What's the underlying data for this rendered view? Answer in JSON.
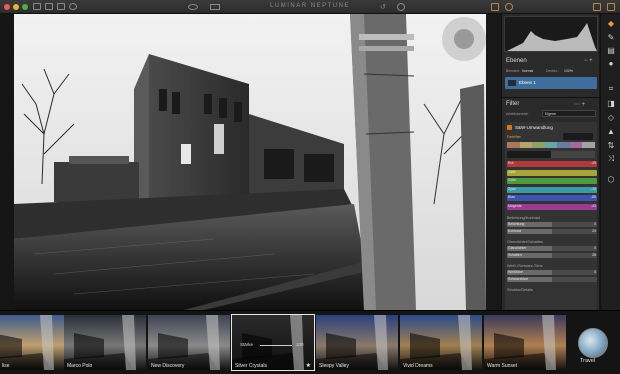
{
  "window": {
    "title": "LUMINAR NEPTUNE"
  },
  "layers": {
    "header": "Ebenen",
    "blend_label": "Blenden:",
    "blend_value": "Normal",
    "opacity_label": "Deckkr.:",
    "opacity_value": "100%",
    "layer_name": "Ebene 1"
  },
  "filter": {
    "header": "Filter",
    "workspace_label": "Arbeitsbereich",
    "workspace_value": "Eigene",
    "name": "S&W-Umwandlung",
    "farbfilter_label": "Farbfilter",
    "farbfilter_button": "Erweitert",
    "tab_luminanz": "Luminanz",
    "tab_saettigung": "Sättigung",
    "channels": [
      {
        "label": "Rot",
        "value": "-45",
        "color": "#b03a3a"
      },
      {
        "label": "Gelb",
        "value": "",
        "color": "#a8a53a"
      },
      {
        "label": "Grün",
        "value": "",
        "color": "#4f9a3c"
      },
      {
        "label": "Zyan",
        "value": "-14",
        "color": "#3b9aa3"
      },
      {
        "label": "Blau",
        "value": "-88",
        "color": "#3b54b0"
      },
      {
        "label": "Magenta",
        "value": "-43",
        "color": "#9a3b92"
      }
    ],
    "section_brightness": "Belichtung/Kontrast",
    "brightness_rows": [
      {
        "label": "Belichtung",
        "value": "0"
      },
      {
        "label": "Kontrast",
        "value": "24"
      }
    ],
    "section_glow": "Glanzlichter/Schatten",
    "glow_rows": [
      {
        "label": "Glanzlichter",
        "value": "0"
      },
      {
        "label": "Schatten",
        "value": "28"
      }
    ],
    "section_whites": "Weiß-/Schwarz-Töne",
    "white_rows": [
      {
        "label": "Weißtöne",
        "value": "0"
      },
      {
        "label": "Schwarztöne",
        "value": ""
      }
    ],
    "section_more": "Struktur/Details"
  },
  "presets": [
    {
      "name": "lise"
    },
    {
      "name": "Marco Polo"
    },
    {
      "name": "New Discovery"
    },
    {
      "name": "Silver Crystals",
      "selected": true,
      "slider_label": "Stärke",
      "slider_value": "100",
      "starred": true
    },
    {
      "name": "Sleepy Valley"
    },
    {
      "name": "Vivid Dreams"
    },
    {
      "name": "Warm Sunset"
    }
  ],
  "category": {
    "name": "Travel"
  },
  "icons": {
    "toolbar": [
      "layers-icon",
      "brush-icon",
      "palette-icon",
      "circle-icon",
      "crop-icon",
      "transform-icon",
      "erase-icon",
      "clone-icon",
      "flip-icon",
      "shuffle-icon",
      "history-icon"
    ]
  }
}
